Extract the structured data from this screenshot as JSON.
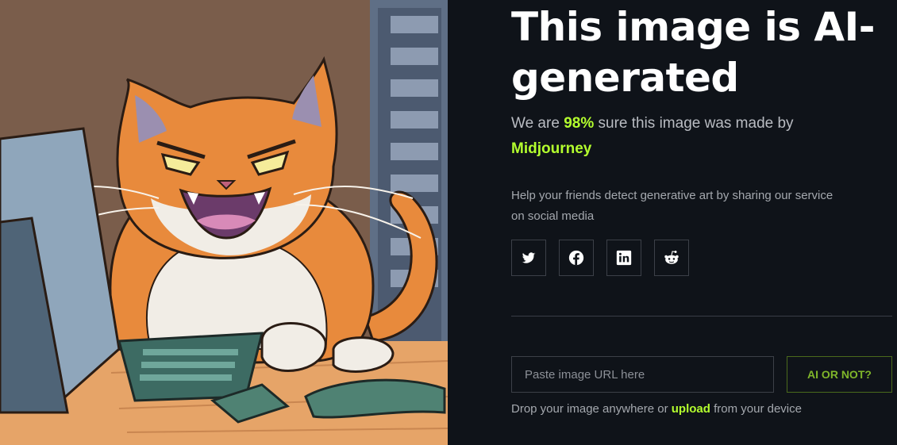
{
  "theme": {
    "background": "#0f1319",
    "accent": "#b4ff2e",
    "button_border": "#4a6a1c"
  },
  "image": {
    "alt": "Illustration of an angry orange cat typing at a computer"
  },
  "result": {
    "title": "This image is AI-generated",
    "verdict_prefix": "We are ",
    "confidence": "98%",
    "verdict_middle": " sure this image was made by ",
    "generator": "Midjourney"
  },
  "share": {
    "text": "Help your friends detect generative art by sharing our service on social media",
    "buttons": [
      {
        "icon": "twitter-icon"
      },
      {
        "icon": "facebook-icon"
      },
      {
        "icon": "linkedin-icon"
      },
      {
        "icon": "reddit-icon"
      }
    ]
  },
  "checker": {
    "url_placeholder": "Paste image URL here",
    "submit_label": "AI OR NOT?",
    "drop_prefix": "Drop your image anywhere or ",
    "upload_link": "upload",
    "drop_suffix": " from your device"
  }
}
